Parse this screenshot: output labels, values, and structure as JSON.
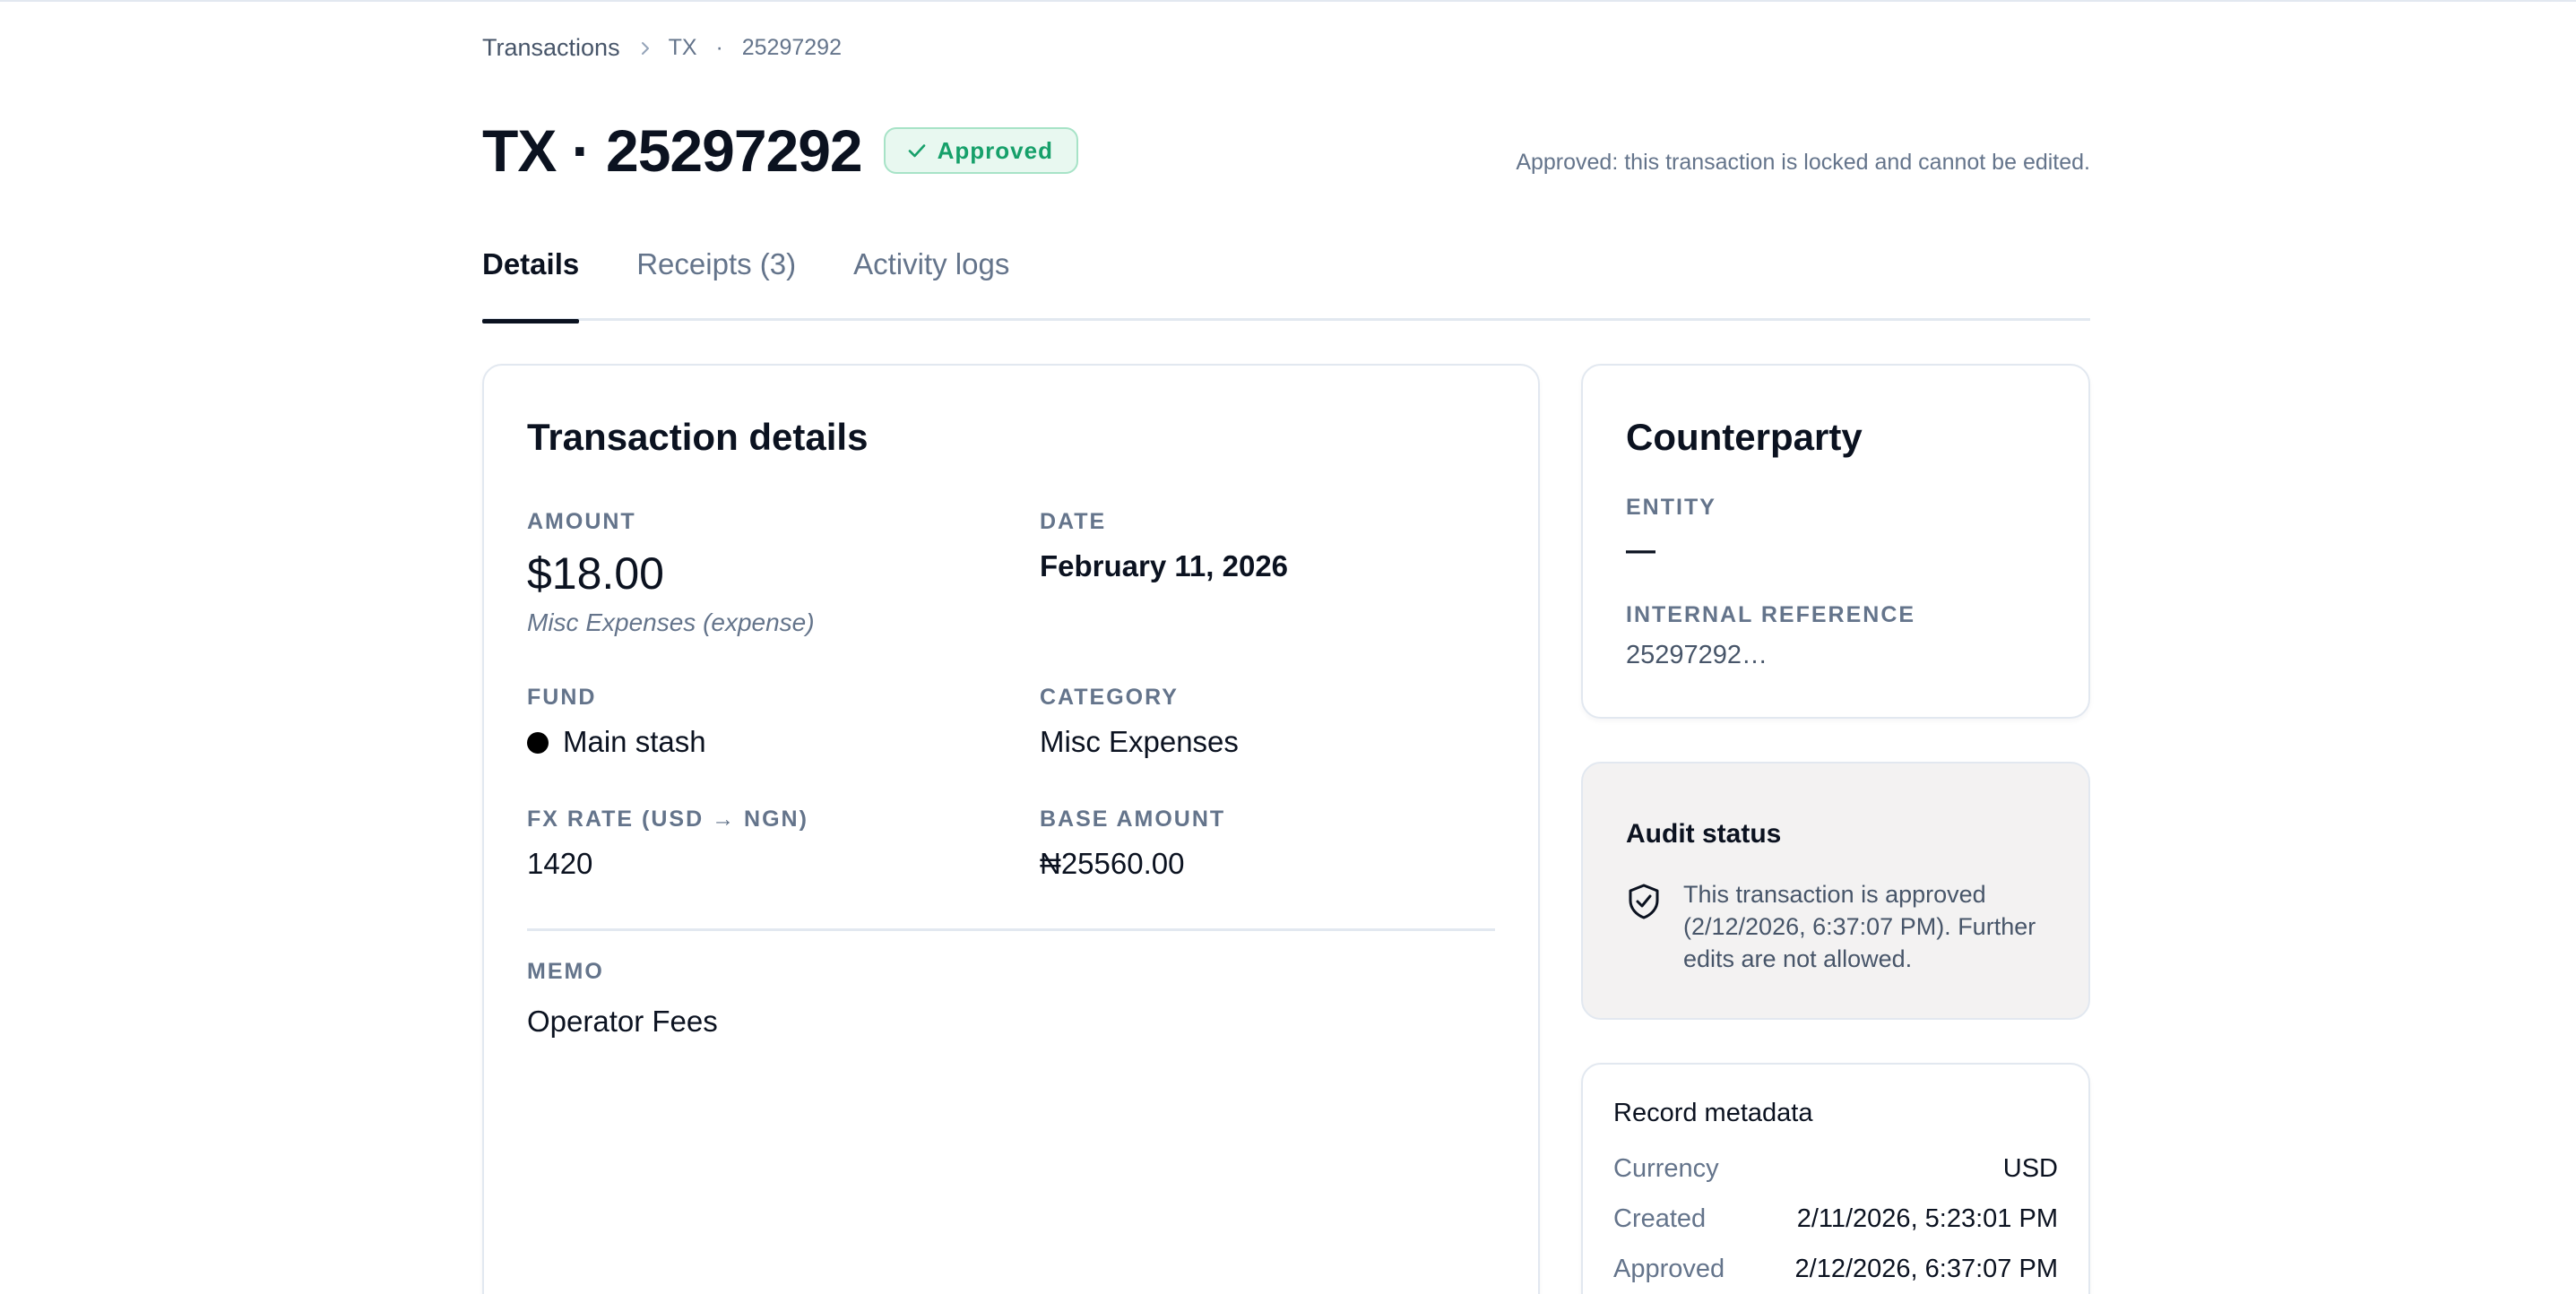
{
  "breadcrumb": {
    "root": "Transactions",
    "current_prefix": "TX",
    "current_dot": "·",
    "current_id": "25297292"
  },
  "header": {
    "title": "TX · 25297292",
    "status_badge": "Approved",
    "lock_note": "Approved: this transaction is locked and cannot be edited."
  },
  "tabs": [
    {
      "label": "Details",
      "active": true
    },
    {
      "label": "Receipts (3)",
      "active": false
    },
    {
      "label": "Activity logs",
      "active": false
    }
  ],
  "transaction_details": {
    "title": "Transaction details",
    "amount": {
      "label": "AMOUNT",
      "value": "$18.00",
      "sub": "Misc Expenses (expense)"
    },
    "date": {
      "label": "DATE",
      "value": "February 11, 2026"
    },
    "fund": {
      "label": "FUND",
      "value": "Main stash",
      "dot_color": "#000000"
    },
    "category": {
      "label": "CATEGORY",
      "value": "Misc Expenses"
    },
    "fx_rate": {
      "label": "FX RATE (USD → NGN)",
      "value": "1420"
    },
    "base_amount": {
      "label": "BASE AMOUNT",
      "value": "₦25560.00"
    },
    "memo": {
      "label": "MEMO",
      "value": "Operator Fees"
    }
  },
  "counterparty": {
    "title": "Counterparty",
    "entity": {
      "label": "ENTITY",
      "value": "—"
    },
    "internal_reference": {
      "label": "INTERNAL REFERENCE",
      "value": "25297292…"
    }
  },
  "audit_status": {
    "title": "Audit status",
    "icon": "shield-check-icon",
    "text": "This transaction is approved (2/12/2026, 6:37:07 PM). Further edits are not allowed."
  },
  "record_metadata": {
    "title": "Record metadata",
    "rows": [
      {
        "key": "Currency",
        "value": "USD"
      },
      {
        "key": "Created",
        "value": "2/11/2026, 5:23:01 PM"
      },
      {
        "key": "Approved",
        "value": "2/12/2026, 6:37:07 PM"
      }
    ]
  },
  "colors": {
    "approved_green": "#16a06a",
    "approved_bg": "#e8f8f0",
    "text_primary": "#0b1220",
    "text_muted": "#64748b"
  }
}
